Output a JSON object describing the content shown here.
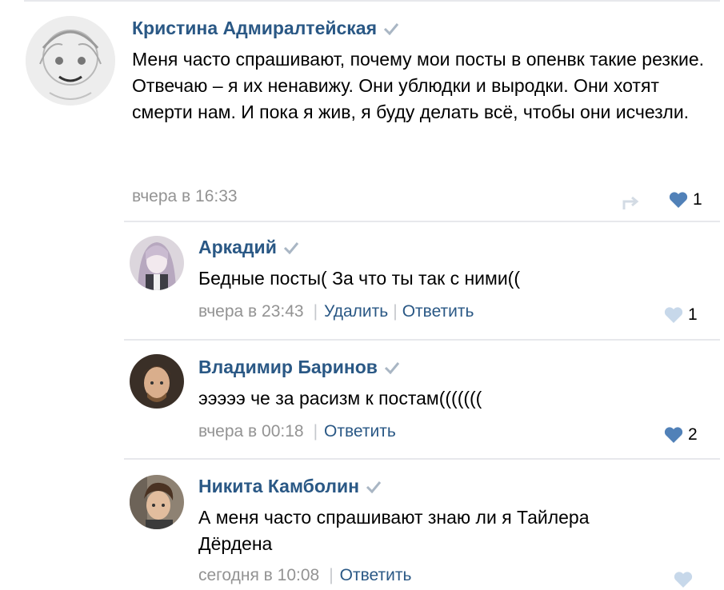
{
  "comments": [
    {
      "author": "Кристина Адмиралтейская",
      "text_lines": [
        "Меня часто спрашивают, почему мои посты в опенвк такие резкие.",
        "Отвечаю – я их ненавижу. Они ублюдки и выродки. Они хотят смерти нам. И пока я жив, я буду делать всё, чтобы они исчезли."
      ],
      "time": "вчера в 16:33",
      "likes": "1",
      "liked": true
    },
    {
      "author": "Аркадий",
      "text_lines": [
        "Бедные посты( За что ты так с ними(("
      ],
      "time": "вчера в 23:43",
      "delete_label": "Удалить",
      "reply_label": "Ответить",
      "likes": "1",
      "liked": false
    },
    {
      "author": "Владимир Баринов",
      "text_lines": [
        "эээээ че за расизм к постам((((((("
      ],
      "time": "вчера в 00:18",
      "reply_label": "Ответить",
      "likes": "2",
      "liked": true
    },
    {
      "author": "Никита Камболин",
      "text_lines": [
        "А меня часто спрашивают знаю ли я Тайлера Дёрдена"
      ],
      "time": "сегодня в 10:08",
      "reply_label": "Ответить",
      "likes": "",
      "liked": false
    }
  ],
  "colors": {
    "link": "#2a5885",
    "meta": "#939393",
    "like_active": "#5181b8",
    "like_inactive": "#c7d8ea",
    "divider": "#e7e8ec"
  },
  "icons": {
    "verified": "checkmark-icon",
    "share": "share-icon",
    "like": "heart-icon"
  }
}
